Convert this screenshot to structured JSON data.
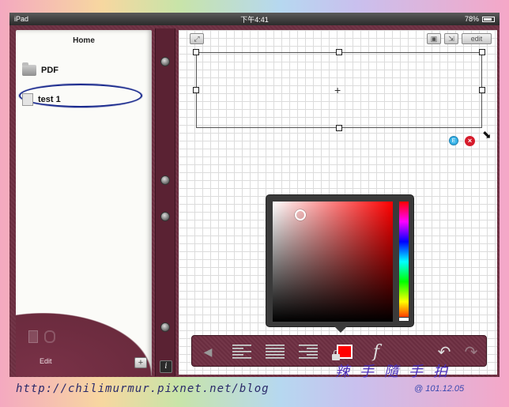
{
  "status_bar": {
    "device": "iPad",
    "time": "下午4:41",
    "battery": "78%"
  },
  "left_page": {
    "title": "Home",
    "files": [
      {
        "name": "PDF",
        "icon": "folder-icon"
      },
      {
        "name": "test 1",
        "icon": "document-icon"
      }
    ],
    "edit_label": "Edit",
    "add_label": "+"
  },
  "spine": {
    "info_label": "i"
  },
  "canvas": {
    "edit_button": "edit",
    "crosshair": "+",
    "edit_badge": "E",
    "delete_badge": "×"
  },
  "color_picker": {
    "selected_color": "#ff0000",
    "hue_color": "#ff0000"
  },
  "toolbar": {
    "font_label": "f",
    "undo": "↶",
    "redo": "↷",
    "back": "◀"
  },
  "watermark": {
    "url": "http://chilimurmur.pixnet.net/blog",
    "signature": "辣 手 隨 手 拍",
    "date": "@ 101.12.05"
  }
}
